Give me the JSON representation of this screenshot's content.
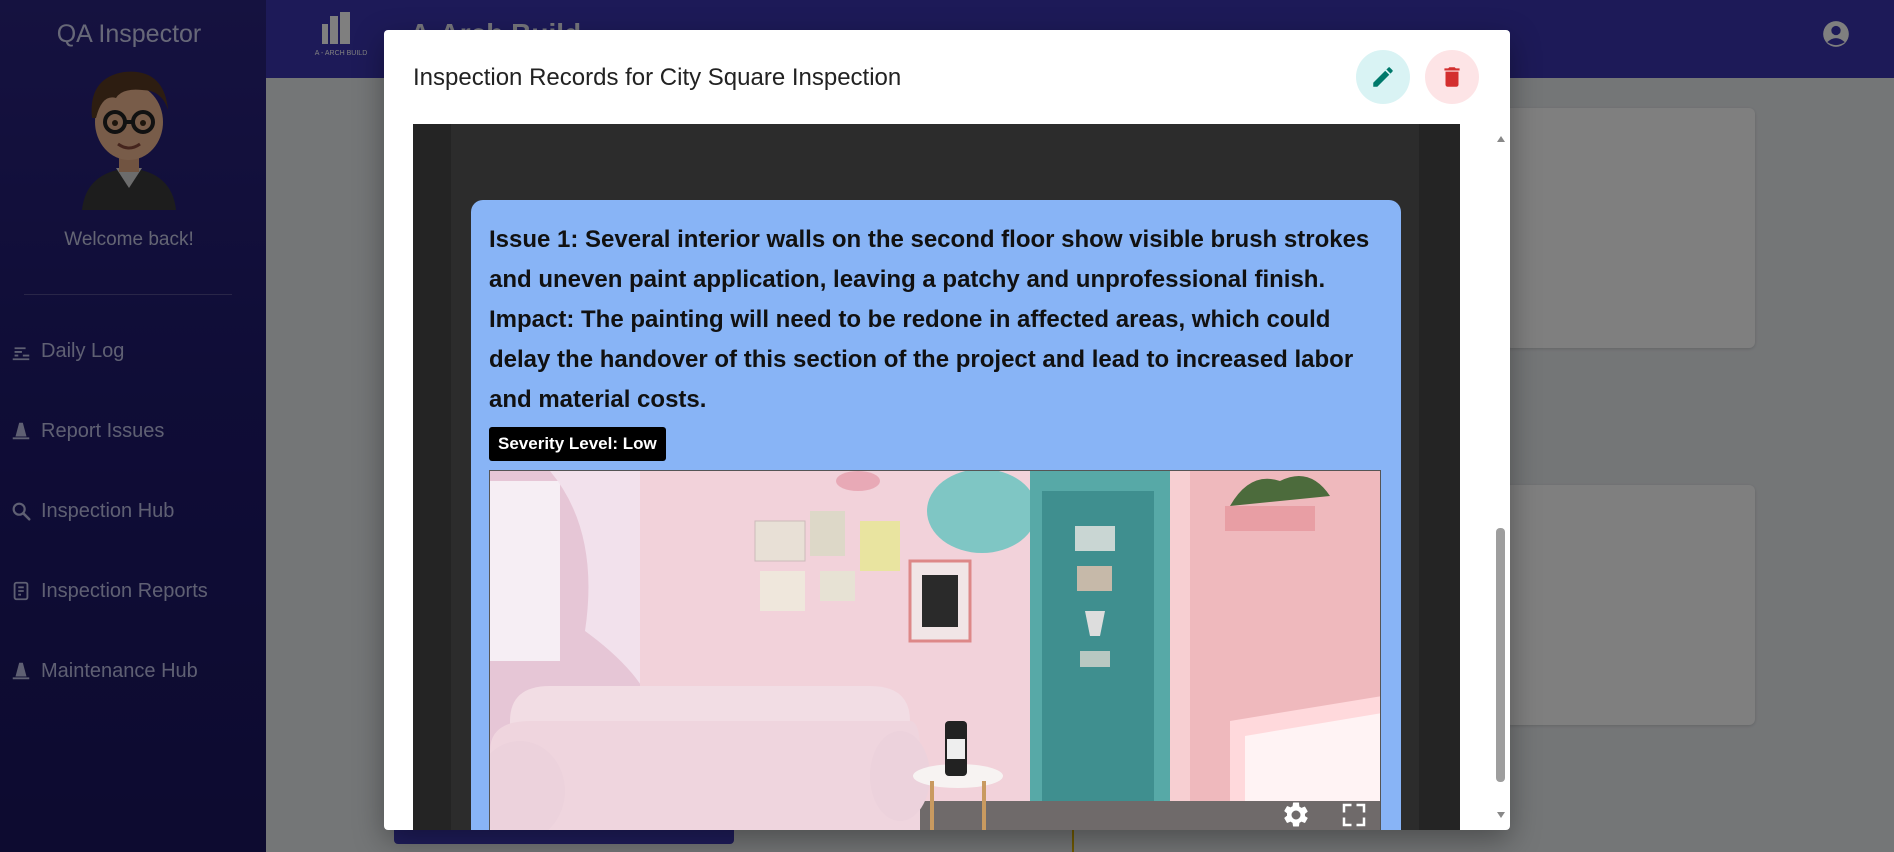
{
  "sidebar": {
    "app_title": "QA Inspector",
    "welcome_text": "Welcome back!",
    "items": [
      {
        "label": "Daily Log",
        "icon": "stairs-icon"
      },
      {
        "label": "Report Issues",
        "icon": "cone-icon"
      },
      {
        "label": "Inspection Hub",
        "icon": "magnify-icon"
      },
      {
        "label": "Inspection Reports",
        "icon": "report-icon"
      },
      {
        "label": "Maintenance Hub",
        "icon": "cone-icon"
      }
    ]
  },
  "topbar": {
    "brand_logo_text": "A - ARCH BUILD",
    "brand_name": "A-Arch Build"
  },
  "modal": {
    "title": "Inspection Records for City Square Inspection",
    "issue": {
      "text": "Issue 1: Several interior walls on the second floor show visible brush strokes and uneven paint application, leaving a patchy and unprofessional finish. Impact: The painting will need to be redone in affected areas, which could delay the handover of this section of the project and lead to increased labor and material costs.",
      "severity": "Severity Level: Low"
    }
  },
  "colors": {
    "sidebar_bg": "#231d78",
    "topbar_bg": "#3b34b0",
    "issue_card_bg": "#88b4f6",
    "edit_accent": "#00796b",
    "delete_accent": "#d32f2f"
  }
}
